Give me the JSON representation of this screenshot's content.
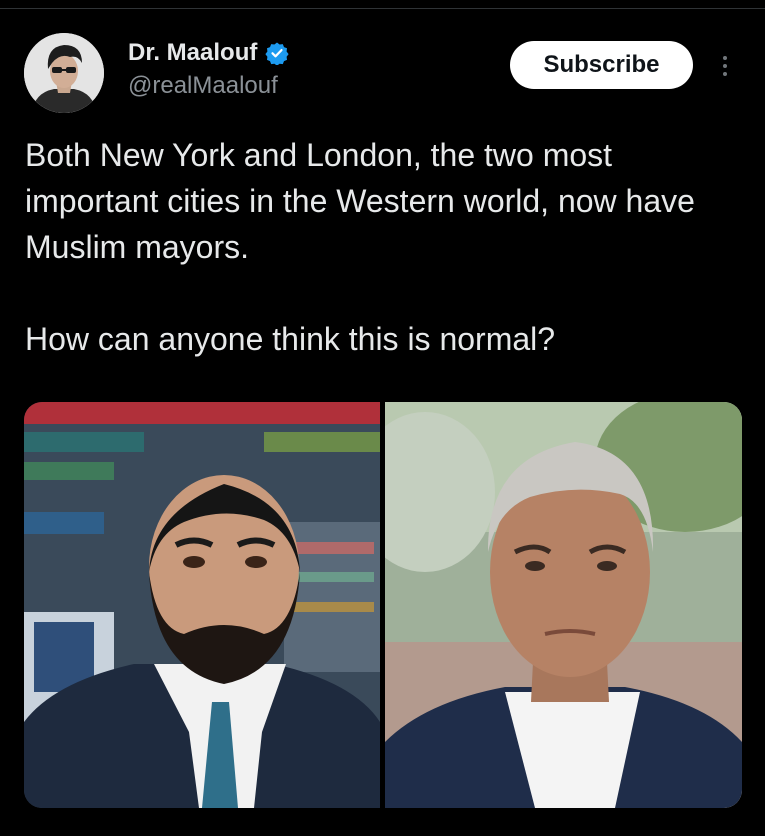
{
  "author": {
    "display_name": "Dr. Maalouf",
    "handle": "@realMaalouf",
    "verified": true,
    "avatar_icon": "profile-photo"
  },
  "actions": {
    "subscribe_label": "Subscribe",
    "more_icon": "three-dots-vertical-icon"
  },
  "tweet": {
    "paragraphs": [
      "Both New York and London, the two most important cities in the Western world, now have Muslim mayors.",
      "How can anyone think this is normal?"
    ]
  },
  "media": {
    "photos": [
      {
        "icon": "portrait-photo",
        "subject": "bearded man in dark suit and blue tie"
      },
      {
        "icon": "portrait-photo",
        "subject": "grey-haired man in navy blazer and white shirt"
      }
    ]
  },
  "colors": {
    "background": "#000000",
    "text": "#e7e9ea",
    "secondary_text": "#8b9197",
    "verified_blue": "#1d9bf0",
    "button_bg": "#ffffff",
    "button_text": "#0f1419"
  }
}
